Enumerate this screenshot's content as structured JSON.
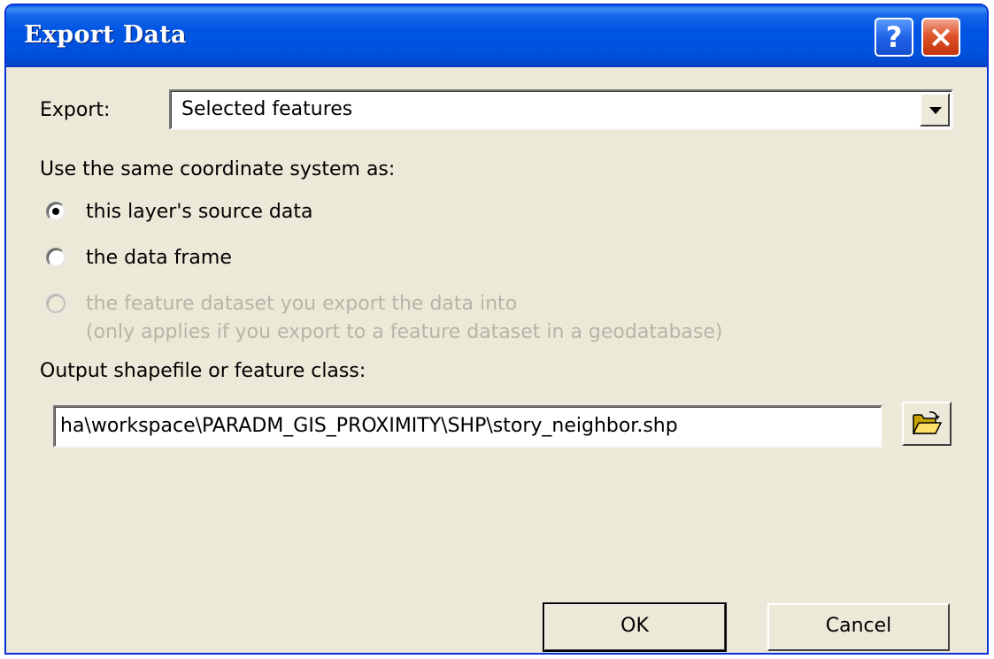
{
  "window": {
    "title": "Export Data",
    "help_label": "?",
    "close_label": "×"
  },
  "export": {
    "label": "Export:",
    "selected_value": "Selected features"
  },
  "coordinate_system": {
    "heading": "Use the same coordinate system as:",
    "options": [
      {
        "label": "this layer's source data",
        "selected": true,
        "enabled": true
      },
      {
        "label": "the data frame",
        "selected": false,
        "enabled": true
      },
      {
        "label": "the feature dataset you export the data into",
        "sublabel": "(only applies if you export to a feature dataset in a geodatabase)",
        "selected": false,
        "enabled": false
      }
    ]
  },
  "output": {
    "label": "Output shapefile or feature class:",
    "path_value": "ha\\workspace\\PARADM_GIS_PROXIMITY\\SHP\\story_neighbor.shp",
    "browse_icon": "folder-open-icon"
  },
  "buttons": {
    "ok_label": "OK",
    "cancel_label": "Cancel"
  },
  "colors": {
    "titlebar": "#0054e3",
    "dialog_background": "#ece9d8",
    "disabled_text": "#b8b5a6"
  }
}
